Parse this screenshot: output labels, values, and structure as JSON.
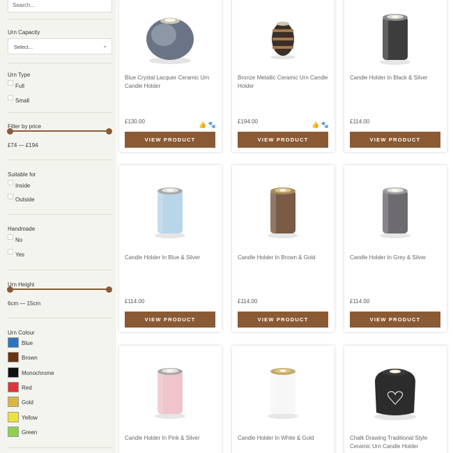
{
  "sidebar": {
    "search_placeholder": "Search...",
    "urn_capacity": {
      "title": "Urn Capacity",
      "selected": "Select..."
    },
    "urn_type": {
      "title": "Urn Type",
      "options": [
        "Full",
        "Small"
      ]
    },
    "price_filter": {
      "title": "Filter by price",
      "range": "£74 — £194"
    },
    "suitable_for": {
      "title": "Suitable for",
      "options": [
        "Inside",
        "Outside"
      ]
    },
    "handmade": {
      "title": "Handmade",
      "options": [
        "No",
        "Yes"
      ]
    },
    "urn_height": {
      "title": "Urn Height",
      "range": "6cm — 15cm"
    },
    "urn_colour": {
      "title": "Urn Colour",
      "colours": [
        {
          "name": "Blue",
          "hex": "#2f73c0"
        },
        {
          "name": "Brown",
          "hex": "#6a3410"
        },
        {
          "name": "Monochrome",
          "hex": "#111111"
        },
        {
          "name": "Red",
          "hex": "#e0353b"
        },
        {
          "name": "Gold",
          "hex": "#dab544"
        },
        {
          "name": "Yellow",
          "hex": "#ede43b"
        },
        {
          "name": "Green",
          "hex": "#8fd14f"
        }
      ]
    }
  },
  "products": [
    {
      "name": "Blue Crystal Lacquer Ceramic Urn Candle Holder",
      "price": "£130.00",
      "button": "VIEW PRODUCT",
      "badges": "👍 🐾",
      "image": "round-blue-grey-ceramic-urn"
    },
    {
      "name": "Bronze Metallic Ceramic Urn Candle Holder",
      "price": "£194.00",
      "button": "VIEW PRODUCT",
      "badges": "👍 🐾",
      "image": "bronze-barrel-urn"
    },
    {
      "name": "Candle Holder In Black & Silver",
      "price": "£114.00",
      "button": "VIEW PRODUCT",
      "badges": "",
      "image": "black-cylinder-urn"
    },
    {
      "name": "Candle Holder In Blue & Silver",
      "price": "£114.00",
      "button": "VIEW PRODUCT",
      "badges": "",
      "image": "blue-cylinder-urn"
    },
    {
      "name": "Candle Holder In Brown & Gold",
      "price": "£114.00",
      "button": "VIEW PRODUCT",
      "badges": "",
      "image": "brown-cylinder-urn"
    },
    {
      "name": "Candle Holder In Grey & Silver",
      "price": "£114.00",
      "button": "VIEW PRODUCT",
      "badges": "",
      "image": "grey-cylinder-urn"
    },
    {
      "name": "Candle Holder In Pink & Silver",
      "price": "",
      "button": "",
      "badges": "",
      "image": "pink-cylinder-urn"
    },
    {
      "name": "Candle Holder In White & Gold",
      "price": "",
      "button": "",
      "badges": "",
      "image": "white-cylinder-urn"
    },
    {
      "name": "Chalk Drawing Traditional Style Ceramic Urn Candle Holder",
      "price": "",
      "button": "",
      "badges": "",
      "image": "black-heart-ceramic-urn"
    }
  ],
  "theme": {
    "accent": "#8a5a34",
    "sidebar_bg": "#f4f4ef"
  }
}
